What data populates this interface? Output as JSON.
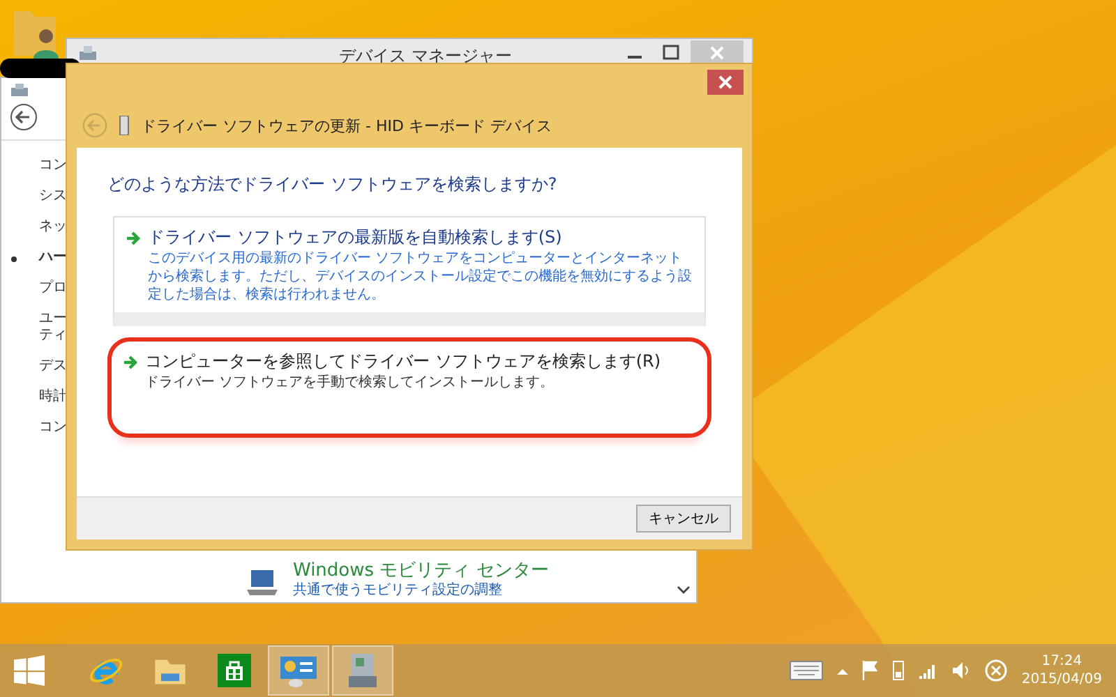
{
  "device_manager": {
    "title": "デバイス マネージャー"
  },
  "control_panel": {
    "sidebar": [
      {
        "label": "コン",
        "selected": false
      },
      {
        "label": "シス",
        "selected": false
      },
      {
        "label": "ネッ",
        "selected": false
      },
      {
        "label": "ハー",
        "selected": true
      },
      {
        "label": "プロ",
        "selected": false
      },
      {
        "label": "ユーティ",
        "selected": false
      },
      {
        "label": "デス",
        "selected": false
      },
      {
        "label": "時計",
        "selected": false
      },
      {
        "label": "コン",
        "selected": false
      }
    ],
    "mobility": {
      "title": "Windows モビリティ センター",
      "link": "共通で使うモビリティ設定の調整"
    }
  },
  "dialog": {
    "title": "ドライバー ソフトウェアの更新 - HID キーボード デバイス",
    "question": "どのような方法でドライバー ソフトウェアを検索しますか?",
    "options": [
      {
        "title": "ドライバー ソフトウェアの最新版を自動検索します(S)",
        "description": "このデバイス用の最新のドライバー ソフトウェアをコンピューターとインターネットから検索します。ただし、デバイスのインストール設定でこの機能を無効にするよう設定した場合は、検索は行われません。",
        "highlighted": false
      },
      {
        "title": "コンピューターを参照してドライバー ソフトウェアを検索します(R)",
        "description": "ドライバー ソフトウェアを手動で検索してインストールします。",
        "highlighted": true
      }
    ],
    "cancel": "キャンセル"
  },
  "taskbar": {
    "apps": [
      {
        "kind": "ie",
        "selected": false
      },
      {
        "kind": "explorer",
        "selected": false
      },
      {
        "kind": "store",
        "selected": false
      },
      {
        "kind": "control",
        "selected": true
      },
      {
        "kind": "devices",
        "selected": true
      }
    ],
    "time": "17:24",
    "date": "2015/04/09"
  }
}
